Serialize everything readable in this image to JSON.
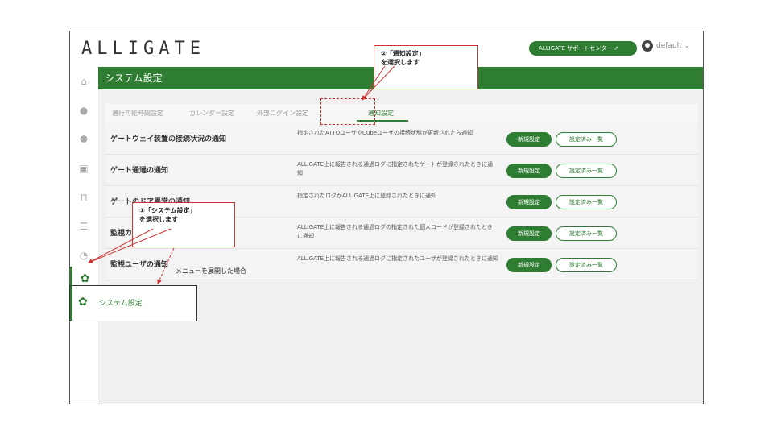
{
  "app": {
    "logo": "ALLIGATE",
    "support_button": "ALLIGATE サポートセンター ↗",
    "user_name": "default ⌄"
  },
  "sidebar": {
    "icons": [
      "home-icon",
      "user-icon",
      "users-icon",
      "id-card-icon",
      "door-icon",
      "list-icon",
      "user-clock-icon",
      "gear-icon"
    ]
  },
  "header": {
    "title": "システム設定"
  },
  "tabs": [
    {
      "label": "通行可能時間設定"
    },
    {
      "label": "カレンダー設定"
    },
    {
      "label": "外部ログイン設定"
    },
    {
      "label": "通知設定",
      "active": true
    }
  ],
  "rows": [
    {
      "title": "ゲートウェイ装置の接続状況の通知",
      "desc": "指定されたATTOユーザやCubeユーザの接続状態が更新されたら通知",
      "new": "新規設定",
      "list": "設定済み一覧"
    },
    {
      "title": "ゲート通過の通知",
      "desc": "ALLIGATE上に報告される通過ログに指定されたゲートが登録されたときに通知",
      "new": "新規設定",
      "list": "設定済み一覧"
    },
    {
      "title": "ゲートのドア異常の通知",
      "desc": "指定されたログがALLIGATE上に登録されたときに通知",
      "new": "新規設定",
      "list": "設定済み一覧"
    },
    {
      "title": "監視カード",
      "desc": "ALLIGATE上に報告される通過ログの指定された個人コードが登録されたときに通知",
      "new": "新規設定",
      "list": "設定済み一覧"
    },
    {
      "title": "監視ユーザの通知",
      "desc": "ALLIGATE上に報告される通過ログに指定されたユーザが登録されたときに通知",
      "new": "新規設定",
      "list": "設定済み一覧"
    }
  ],
  "annotations": {
    "callout1_line1": "①「システム設定」",
    "callout1_line2": "を選択します",
    "callout2_line1": "②「通知設定」",
    "callout2_line2": "を選択します",
    "expanded_label": "システム設定",
    "expanded_note": "メニューを展開した場合"
  },
  "colors": {
    "accent": "#2e7d32",
    "callout_border": "#cc3333"
  }
}
